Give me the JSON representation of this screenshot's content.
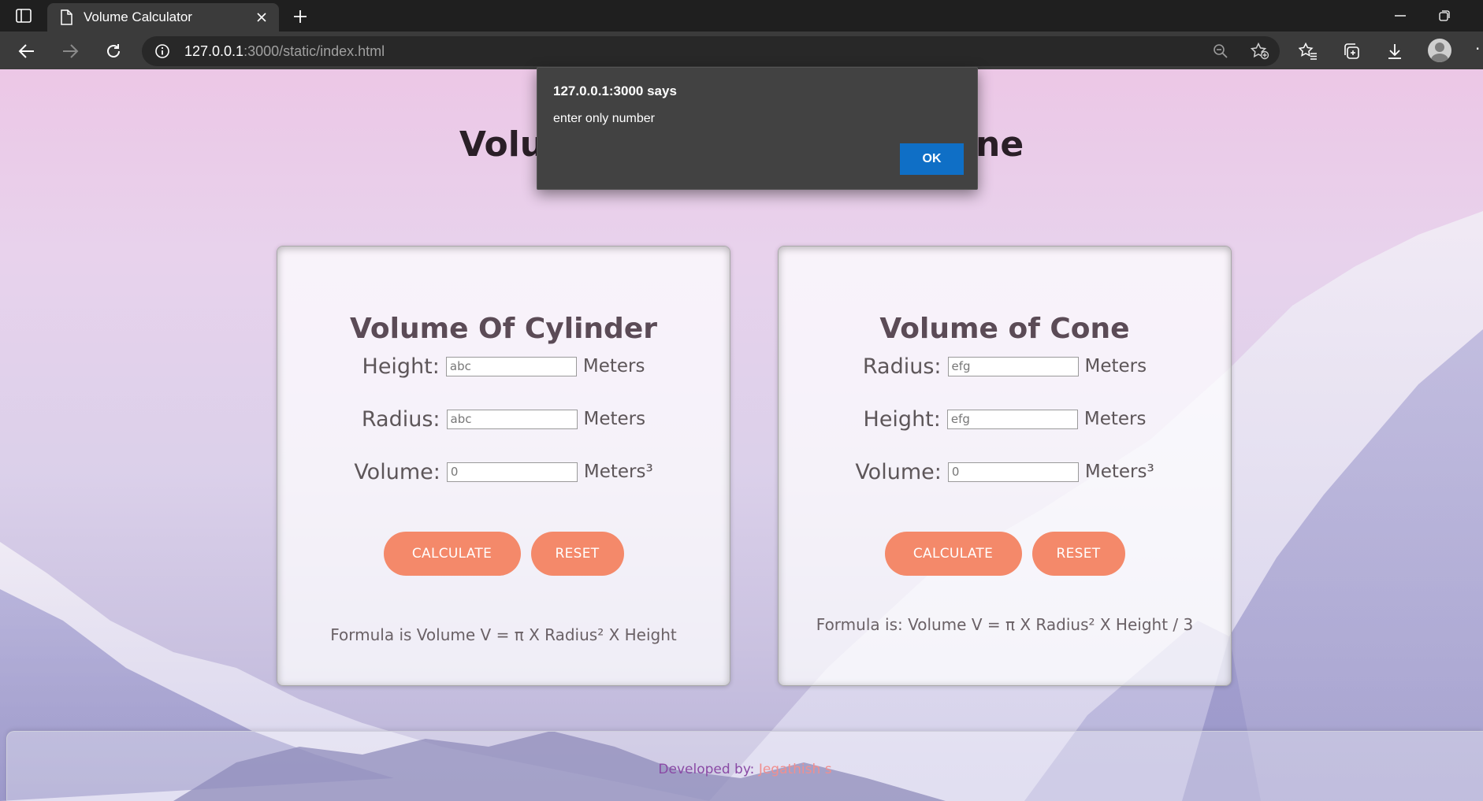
{
  "browser": {
    "tab_title": "Volume Calculator",
    "url_host": "127.0.0.1",
    "url_rest": ":3000/static/index.html",
    "icons": [
      "tab-actions-icon",
      "document-icon",
      "close-icon",
      "plus-icon",
      "minimize-icon",
      "restore-icon",
      "back-icon",
      "forward-icon",
      "refresh-icon",
      "info-icon",
      "zoom-out-icon",
      "add-favorite-icon",
      "favorites-icon",
      "collections-icon",
      "download-icon",
      "profile-icon",
      "more-icon"
    ]
  },
  "page": {
    "title": "Volume of Cylinder and Cone"
  },
  "cylinder": {
    "heading": "Volume Of Cylinder",
    "height_label": "Height:",
    "height_value": "abc",
    "radius_label": "Radius:",
    "radius_value": "abc",
    "volume_label": "Volume:",
    "volume_value": "0",
    "unit": "Meters",
    "volume_unit": "Meters³",
    "calculate_label": "CALCULATE",
    "reset_label": "RESET",
    "formula": "Formula is Volume V = π X Radius² X Height"
  },
  "cone": {
    "heading": "Volume of Cone",
    "radius_label": "Radius:",
    "radius_value": "efg",
    "height_label": "Height:",
    "height_value": "efg",
    "volume_label": "Volume:",
    "volume_value": "0",
    "unit": "Meters",
    "volume_unit": "Meters³",
    "calculate_label": "CALCULATE",
    "reset_label": "RESET",
    "formula": "Formula is: Volume V = π X Radius² X Height / 3"
  },
  "footer": {
    "prefix": "Developed by: ",
    "author": "Jegathish s"
  },
  "dialog": {
    "title": "127.0.0.1:3000 says",
    "message": "enter only number",
    "ok_label": "OK"
  },
  "colors": {
    "button": "#f4896a",
    "dialog_bg": "#424242",
    "ok_button": "#0f6fc6",
    "footer_prefix": "#8a4aa5",
    "footer_author": "#f08f8f"
  }
}
